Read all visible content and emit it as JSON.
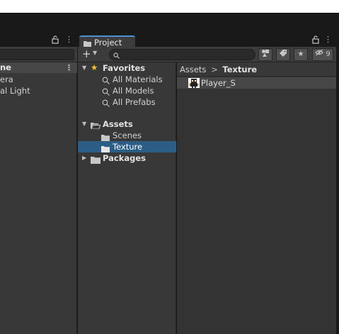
{
  "hierarchy": {
    "scene_label": "ne",
    "items": [
      {
        "label": "era"
      },
      {
        "label": "al Light"
      }
    ]
  },
  "project": {
    "tab_label": "Project",
    "hidden_count": "9",
    "favorites": {
      "label": "Favorites",
      "items": [
        {
          "label": "All Materials"
        },
        {
          "label": "All Models"
        },
        {
          "label": "All Prefabs"
        }
      ]
    },
    "assets": {
      "label": "Assets",
      "children": [
        {
          "label": "Scenes"
        },
        {
          "label": "Texture"
        }
      ]
    },
    "packages": {
      "label": "Packages"
    },
    "breadcrumb": {
      "root": "Assets",
      "separator": ">",
      "current": "Texture"
    },
    "content": {
      "items": [
        {
          "label": "Player_S"
        }
      ]
    }
  },
  "colors": {
    "accent": "#4d8fd5",
    "selection": "#2c5d87",
    "star": "#f2c230"
  }
}
